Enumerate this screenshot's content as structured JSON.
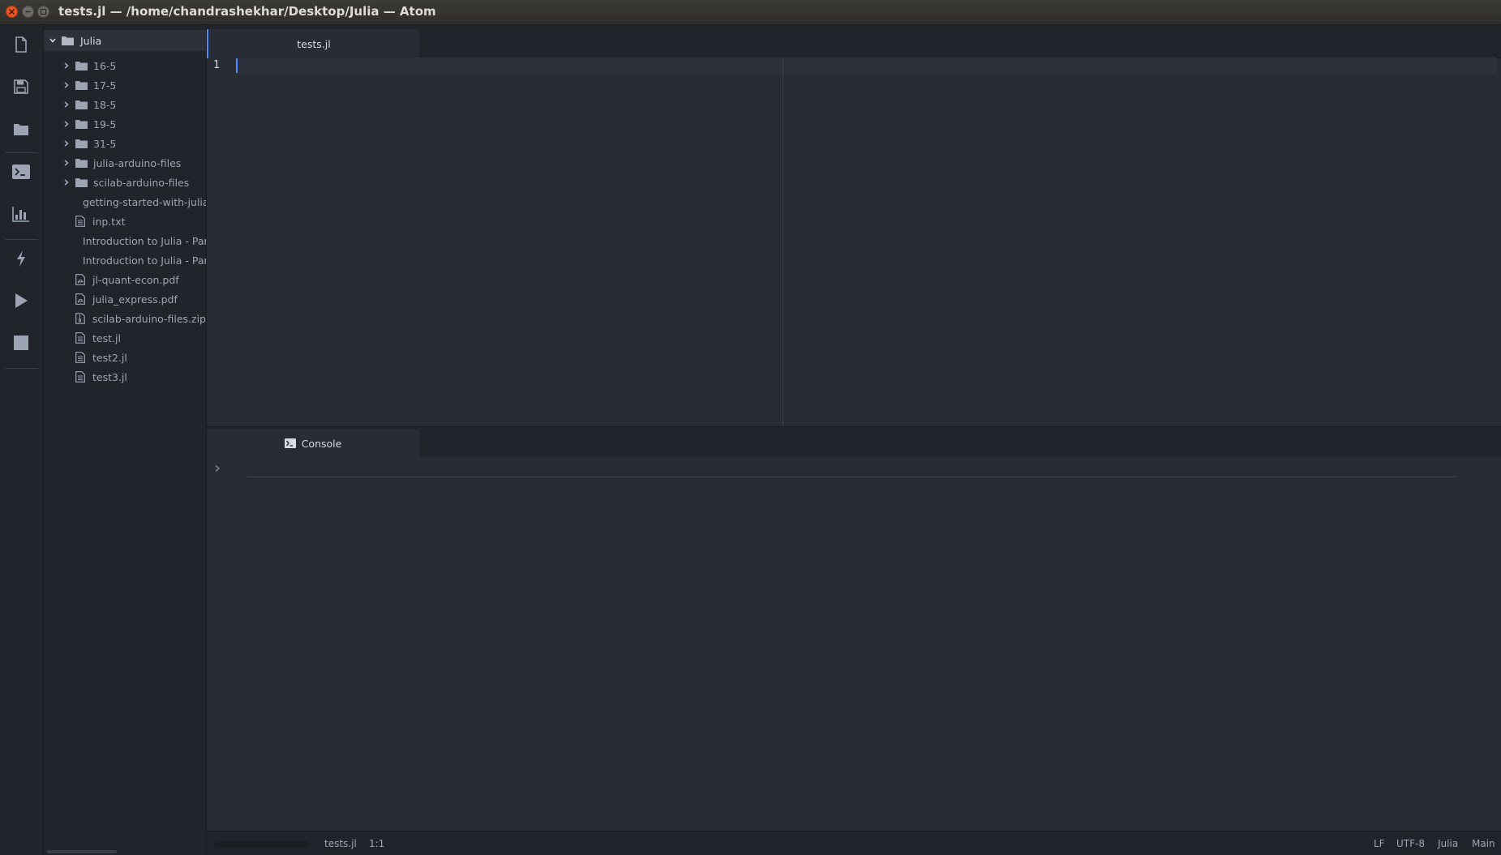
{
  "window": {
    "title": "tests.jl — /home/chandrashekhar/Desktop/Julia — Atom"
  },
  "toolbar": {
    "buttons": [
      {
        "name": "new-file-icon"
      },
      {
        "name": "save-icon"
      },
      {
        "name": "open-folder-icon"
      },
      {
        "name": "terminal-icon"
      },
      {
        "name": "plot-pane-icon"
      },
      {
        "name": "lightning-icon"
      },
      {
        "name": "run-icon"
      },
      {
        "name": "stop-icon"
      }
    ]
  },
  "tree": {
    "root": "Julia",
    "folders": [
      "16-5",
      "17-5",
      "18-5",
      "19-5",
      "31-5",
      "julia-arduino-files",
      "scilab-arduino-files"
    ],
    "files": [
      {
        "label": "getting-started-with-julia-",
        "icon": "pdf-file-icon"
      },
      {
        "label": "inp.txt",
        "icon": "text-file-icon"
      },
      {
        "label": "Introduction to Julia - Part",
        "icon": "text-file-icon"
      },
      {
        "label": "Introduction to Julia - Part",
        "icon": "text-file-icon"
      },
      {
        "label": "jl-quant-econ.pdf",
        "icon": "pdf-file-icon"
      },
      {
        "label": "julia_express.pdf",
        "icon": "pdf-file-icon"
      },
      {
        "label": "scilab-arduino-files.zip",
        "icon": "zip-file-icon"
      },
      {
        "label": "test.jl",
        "icon": "text-file-icon"
      },
      {
        "label": "test2.jl",
        "icon": "text-file-icon"
      },
      {
        "label": "test3.jl",
        "icon": "text-file-icon"
      }
    ]
  },
  "editor": {
    "tab_label": "tests.jl",
    "line_number": "1"
  },
  "console": {
    "tab_label": "Console"
  },
  "status": {
    "file": "tests.jl",
    "cursor": "1:1",
    "line_ending": "LF",
    "encoding": "UTF-8",
    "grammar": "Julia",
    "module": "Main"
  },
  "colors": {
    "accent": "#568af2",
    "background": "#282c34",
    "panel": "#21252b"
  }
}
